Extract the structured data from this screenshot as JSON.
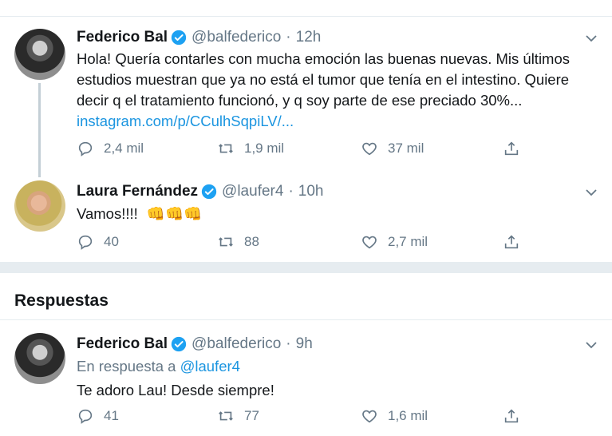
{
  "tweets": [
    {
      "name": "Federico Bal",
      "handle": "@balfederico",
      "time": "12h",
      "text_lines": [
        "Hola! Quería contarles con mucha emoción las buenas nuevas. Mis últimos",
        "estudios muestran que ya no está el tumor que tenía en el intestino. Quiere",
        "decir q el tratamiento funcionó, y q soy parte de ese preciado 30%..."
      ],
      "link": "instagram.com/p/CCulhSqpiLV/...",
      "replies": "2,4 mil",
      "retweets": "1,9 mil",
      "likes": "37 mil"
    },
    {
      "name": "Laura Fernández",
      "handle": "@laufer4",
      "time": "10h",
      "text": "Vamos!!!!",
      "emoji": "👊👊👊",
      "replies": "40",
      "retweets": "88",
      "likes": "2,7 mil"
    }
  ],
  "section_title": "Respuestas",
  "reply": {
    "name": "Federico Bal",
    "handle": "@balfederico",
    "time": "9h",
    "in_reply_prefix": "En respuesta a",
    "in_reply_handle": "@laufer4",
    "text": "Te adoro Lau! Desde siempre!",
    "replies": "41",
    "retweets": "77",
    "likes": "1,6 mil"
  },
  "separator": "·",
  "colors": {
    "accent": "#1b95e0",
    "muted": "#657786",
    "divider": "#e6ecf0"
  }
}
